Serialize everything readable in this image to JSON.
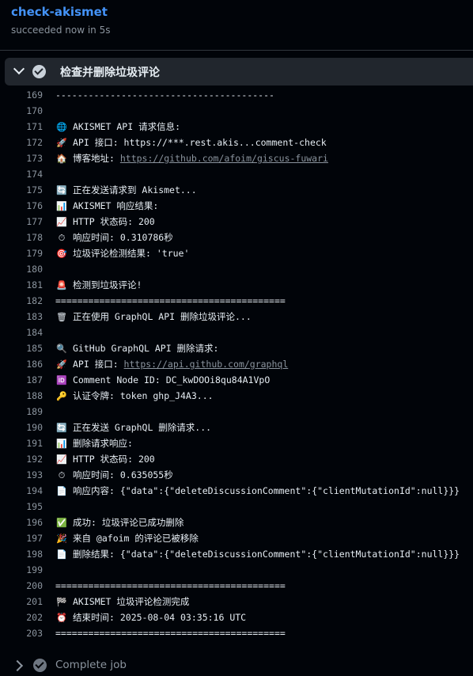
{
  "job": {
    "title": "check-akismet",
    "status": "succeeded now in 5s"
  },
  "step": {
    "title": "检查并删除垃圾评论"
  },
  "lines": [
    {
      "n": "169",
      "icon": "",
      "pre": "----------------------------------------",
      "link": "",
      "post": ""
    },
    {
      "n": "170",
      "icon": "",
      "pre": "",
      "link": "",
      "post": ""
    },
    {
      "n": "171",
      "icon": "🌐",
      "pre": "AKISMET API 请求信息:",
      "link": "",
      "post": ""
    },
    {
      "n": "172",
      "icon": "🚀",
      "pre": "API 接口: https://***.rest.akis...comment-check",
      "link": "",
      "post": ""
    },
    {
      "n": "173",
      "icon": "🏠",
      "pre": "博客地址: ",
      "link": "https://github.com/afoim/giscus-fuwari",
      "post": ""
    },
    {
      "n": "174",
      "icon": "",
      "pre": "",
      "link": "",
      "post": ""
    },
    {
      "n": "175",
      "icon": "🔄",
      "pre": "正在发送请求到 Akismet...",
      "link": "",
      "post": ""
    },
    {
      "n": "176",
      "icon": "📊",
      "pre": "AKISMET 响应结果:",
      "link": "",
      "post": ""
    },
    {
      "n": "177",
      "icon": "📈",
      "pre": "HTTP 状态码: 200",
      "link": "",
      "post": ""
    },
    {
      "n": "178",
      "icon": "⏱",
      "pre": "响应时间: 0.310786秒",
      "link": "",
      "post": ""
    },
    {
      "n": "179",
      "icon": "🎯",
      "pre": "垃圾评论检测结果: 'true'",
      "link": "",
      "post": ""
    },
    {
      "n": "180",
      "icon": "",
      "pre": "",
      "link": "",
      "post": ""
    },
    {
      "n": "181",
      "icon": "🚨",
      "pre": "检测到垃圾评论!",
      "link": "",
      "post": ""
    },
    {
      "n": "182",
      "icon": "",
      "pre": "==========================================",
      "link": "",
      "post": ""
    },
    {
      "n": "183",
      "icon": "🗑",
      "pre": "正在使用 GraphQL API 删除垃圾评论...",
      "link": "",
      "post": ""
    },
    {
      "n": "184",
      "icon": "",
      "pre": "",
      "link": "",
      "post": ""
    },
    {
      "n": "185",
      "icon": "🔍",
      "pre": "GitHub GraphQL API 删除请求:",
      "link": "",
      "post": ""
    },
    {
      "n": "186",
      "icon": "🚀",
      "pre": "API 接口: ",
      "link": "https://api.github.com/graphql",
      "post": ""
    },
    {
      "n": "187",
      "icon": "🆔",
      "pre": "Comment Node ID: DC_kwDOOi8qu84A1VpO",
      "link": "",
      "post": ""
    },
    {
      "n": "188",
      "icon": "🔑",
      "pre": "认证令牌: token ghp_J4A3...",
      "link": "",
      "post": ""
    },
    {
      "n": "189",
      "icon": "",
      "pre": "",
      "link": "",
      "post": ""
    },
    {
      "n": "190",
      "icon": "🔄",
      "pre": "正在发送 GraphQL 删除请求...",
      "link": "",
      "post": ""
    },
    {
      "n": "191",
      "icon": "📊",
      "pre": "删除请求响应:",
      "link": "",
      "post": ""
    },
    {
      "n": "192",
      "icon": "📈",
      "pre": "HTTP 状态码: 200",
      "link": "",
      "post": ""
    },
    {
      "n": "193",
      "icon": "⏱",
      "pre": "响应时间: 0.635055秒",
      "link": "",
      "post": ""
    },
    {
      "n": "194",
      "icon": "📄",
      "pre": "响应内容: {\"data\":{\"deleteDiscussionComment\":{\"clientMutationId\":null}}}",
      "link": "",
      "post": ""
    },
    {
      "n": "195",
      "icon": "",
      "pre": "",
      "link": "",
      "post": ""
    },
    {
      "n": "196",
      "icon": "✅",
      "pre": "成功: 垃圾评论已成功删除",
      "link": "",
      "post": ""
    },
    {
      "n": "197",
      "icon": "🎉",
      "pre": "来自 @afoim 的评论已被移除",
      "link": "",
      "post": ""
    },
    {
      "n": "198",
      "icon": "📄",
      "pre": "删除结果: {\"data\":{\"deleteDiscussionComment\":{\"clientMutationId\":null}}}",
      "link": "",
      "post": ""
    },
    {
      "n": "199",
      "icon": "",
      "pre": "",
      "link": "",
      "post": ""
    },
    {
      "n": "200",
      "icon": "",
      "pre": "==========================================",
      "link": "",
      "post": ""
    },
    {
      "n": "201",
      "icon": "🏁",
      "pre": "AKISMET 垃圾评论检测完成",
      "link": "",
      "post": ""
    },
    {
      "n": "202",
      "icon": "⏰",
      "pre": "结束时间: 2025-08-04 03:35:16 UTC",
      "link": "",
      "post": ""
    },
    {
      "n": "203",
      "icon": "",
      "pre": "==========================================",
      "link": "",
      "post": ""
    }
  ],
  "next_step": {
    "title": "Complete job"
  }
}
